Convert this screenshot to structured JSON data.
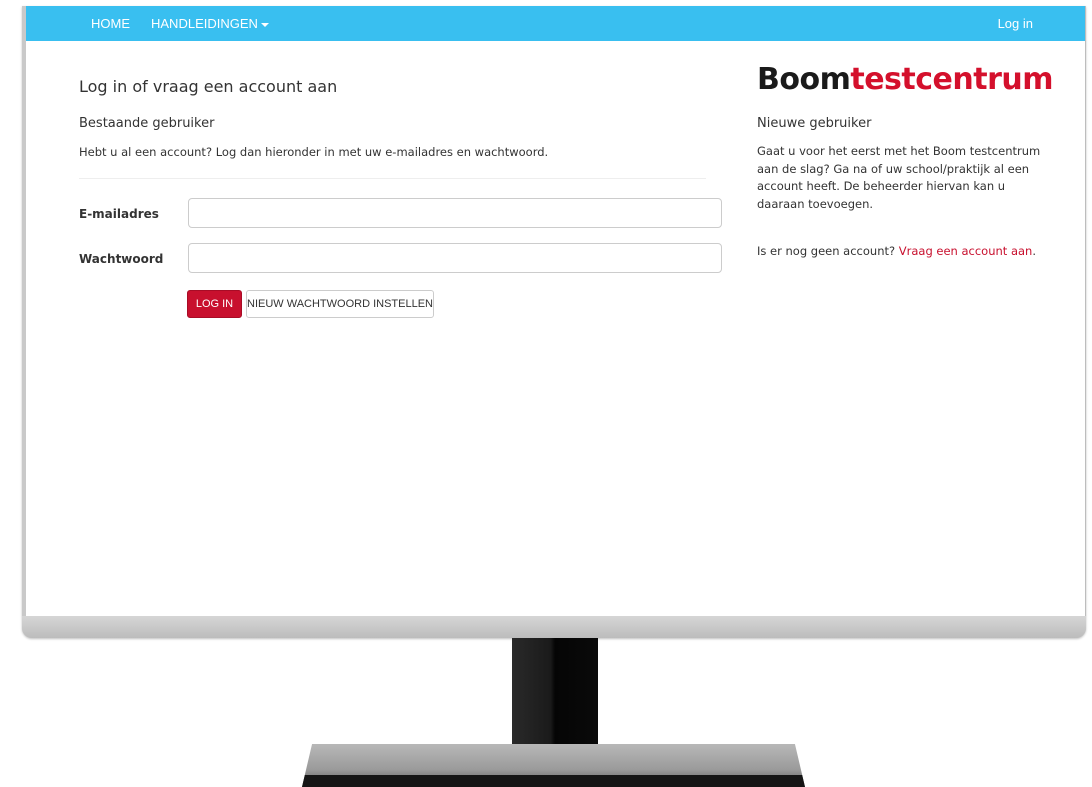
{
  "navbar": {
    "home_label": "HOME",
    "manuals_label": "HANDLEIDINGEN",
    "login_label": "Log in",
    "bg_color": "#39bff0"
  },
  "login": {
    "page_title": "Log in of vraag een account aan",
    "section_title": "Bestaande gebruiker",
    "intro": "Hebt u al een account? Log dan hieronder in met uw e-mailadres en wachtwoord.",
    "email_label": "E-mailadres",
    "email_value": "",
    "password_label": "Wachtwoord",
    "password_value": "",
    "login_button": "LOG IN",
    "reset_button": "NIEUW WACHTWOORD INSTELLEN",
    "primary_color": "#c8102e"
  },
  "brand": {
    "part1": "Boom",
    "part2": "testcentrum"
  },
  "newuser": {
    "title": "Nieuwe gebruiker",
    "body": "Gaat u voor het eerst met het Boom testcentrum aan de slag? Ga na of uw school/praktijk al een account heeft. De beheerder hiervan kan u daaraan toevoegen.",
    "footer_text": "Is er nog geen account? ",
    "footer_link": "Vraag een account aan",
    "footer_end": "."
  }
}
